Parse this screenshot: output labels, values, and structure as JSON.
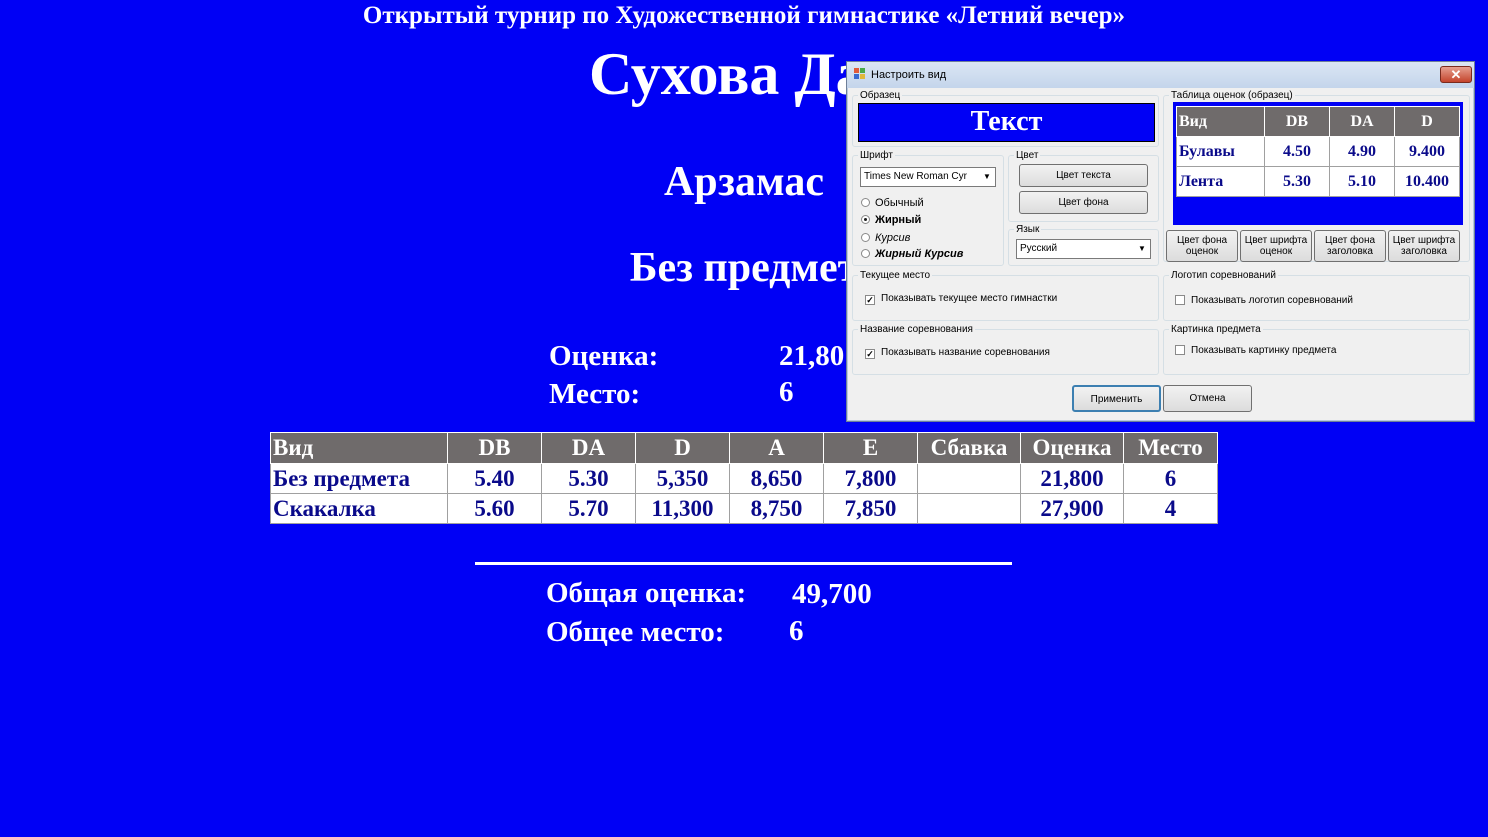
{
  "background": "#0000f5",
  "competition_title": "Открытый турнир по Художественной гимнастике «Летний вечер»",
  "athlete_name": "Сухова Дар",
  "city": "Арзамас",
  "apparatus": "Без предмет",
  "score": {
    "label": "Оценка:",
    "value": "21,80"
  },
  "place": {
    "label": "Место:",
    "value": "6"
  },
  "results_table": {
    "headers": [
      "Вид",
      "DB",
      "DA",
      "D",
      "A",
      "E",
      "Сбавка",
      "Оценка",
      "Место"
    ],
    "rows": [
      [
        "Без предмета",
        "5.40",
        "5.30",
        "5,350",
        "8,650",
        "7,800",
        "",
        "21,800",
        "6"
      ],
      [
        "Скакалка",
        "5.60",
        "5.70",
        "11,300",
        "8,750",
        "7,850",
        "",
        "27,900",
        "4"
      ]
    ]
  },
  "total_score": {
    "label": "Общая оценка:",
    "value": "49,700"
  },
  "total_place": {
    "label": "Общее место:",
    "value": "6"
  },
  "dialog": {
    "title": "Настроить вид",
    "close_icon": "close-icon",
    "sample_group": "Образец",
    "sample_text": "Текст",
    "font_group": "Шрифт",
    "font_value": "Times New Roman Cyr",
    "font_styles": [
      "Обычный",
      "Жирный",
      "Курсив",
      "Жирный Курсив"
    ],
    "selected_style": "Жирный",
    "color_group": "Цвет",
    "text_color_button": "Цвет текста",
    "bg_color_button": "Цвет фона",
    "language_group": "Язык",
    "language_value": "Русский",
    "preview_group": "Таблица оценок (образец)",
    "preview_table": {
      "headers": [
        "Вид",
        "DB",
        "DA",
        "D"
      ],
      "rows": [
        [
          "Булавы",
          "4.50",
          "4.90",
          "9.400"
        ],
        [
          "Лента",
          "5.30",
          "5.10",
          "10.400"
        ]
      ]
    },
    "score_bg_button": [
      "Цвет фона",
      "оценок"
    ],
    "score_font_button": [
      "Цвет шрифта",
      "оценок"
    ],
    "header_bg_button": [
      "Цвет фона",
      "заголовка"
    ],
    "header_font_button": [
      "Цвет шрифта",
      "заголовка"
    ],
    "current_place_group": "Текущее место",
    "current_place_check": "Показывать текущее место гимнастки",
    "current_place_checked": true,
    "logo_group": "Логотип соревнований",
    "logo_check": "Показывать логотип соревнований",
    "logo_checked": false,
    "comp_name_group": "Название соревнования",
    "comp_name_check": "Показывать название соревнования",
    "comp_name_checked": true,
    "apparatus_pic_group": "Картинка предмета",
    "apparatus_pic_check": "Показывать картинку предмета",
    "apparatus_pic_checked": false,
    "apply_button": "Применить",
    "cancel_button": "Отмена"
  }
}
